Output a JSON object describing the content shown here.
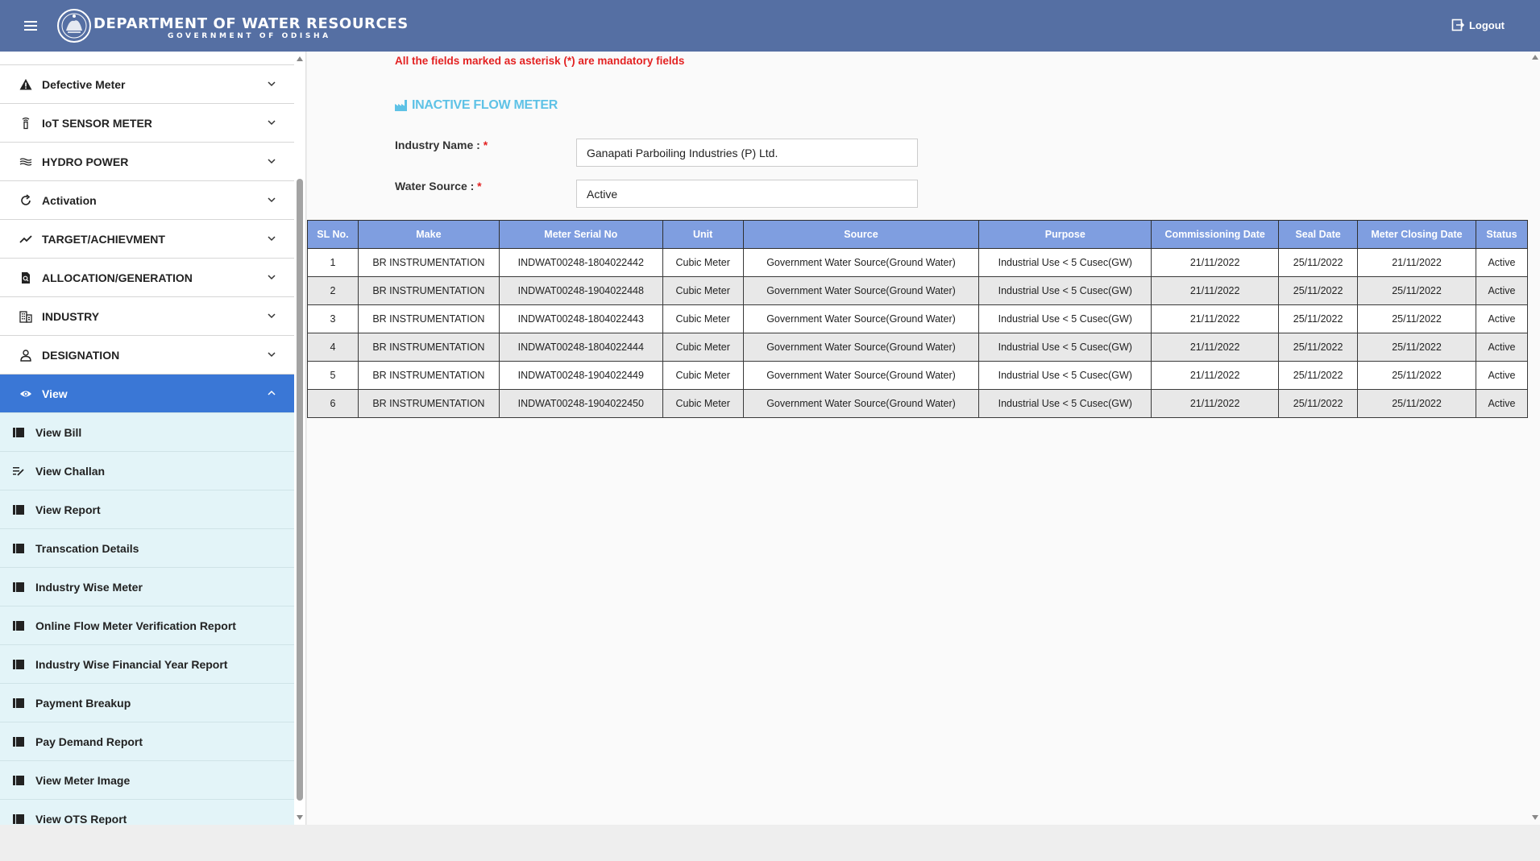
{
  "header": {
    "title": "DEPARTMENT OF WATER RESOURCES",
    "subtitle": "GOVERNMENT OF ODISHA",
    "logout_label": "Logout"
  },
  "sidebar": {
    "menu": [
      {
        "label": "Defective Meter",
        "icon": "warning-icon"
      },
      {
        "label": "IoT SENSOR METER",
        "icon": "sensor-icon"
      },
      {
        "label": "HYDRO POWER",
        "icon": "waves-icon"
      },
      {
        "label": "Activation",
        "icon": "refresh-icon"
      },
      {
        "label": "TARGET/ACHIEVMENT",
        "icon": "trend-icon"
      },
      {
        "label": "ALLOCATION/GENERATION",
        "icon": "document-search-icon"
      },
      {
        "label": "INDUSTRY",
        "icon": "building-icon"
      },
      {
        "label": "DESIGNATION",
        "icon": "person-icon"
      }
    ],
    "active_menu": {
      "label": "View",
      "icon": "eye-icon"
    },
    "sub_items": [
      {
        "label": "View Bill",
        "icon": "list-icon"
      },
      {
        "label": "View Challan",
        "icon": "edit-list-icon"
      },
      {
        "label": "View Report",
        "icon": "list-icon"
      },
      {
        "label": "Transcation Details",
        "icon": "list-icon"
      },
      {
        "label": "Industry Wise Meter",
        "icon": "list-icon"
      },
      {
        "label": "Online Flow Meter Verification Report",
        "icon": "list-icon"
      },
      {
        "label": "Industry Wise Financial Year Report",
        "icon": "list-icon"
      },
      {
        "label": "Payment Breakup",
        "icon": "list-icon"
      },
      {
        "label": "Pay Demand Report",
        "icon": "list-icon"
      },
      {
        "label": "View Meter Image",
        "icon": "list-icon"
      },
      {
        "label": "View OTS Report",
        "icon": "list-icon"
      }
    ]
  },
  "main": {
    "mandatory_note": "All the fields marked as asterisk (*) are mandatory fields",
    "section_title": "INACTIVE FLOW METER",
    "industry_label": "Industry Name :",
    "industry_value": "Ganapati Parboiling Industries (P) Ltd.",
    "water_source_label": "Water Source :",
    "water_source_value": "Active",
    "required_mark": "*"
  },
  "table": {
    "columns": [
      "SL No.",
      "Make",
      "Meter Serial No",
      "Unit",
      "Source",
      "Purpose",
      "Commissioning Date",
      "Seal Date",
      "Meter Closing Date",
      "Status"
    ],
    "rows": [
      [
        "1",
        "BR INSTRUMENTATION",
        "INDWAT00248-1804022442",
        "Cubic Meter",
        "Government Water Source(Ground Water)",
        "Industrial Use < 5 Cusec(GW)",
        "21/11/2022",
        "25/11/2022",
        "21/11/2022",
        "Active"
      ],
      [
        "2",
        "BR INSTRUMENTATION",
        "INDWAT00248-1904022448",
        "Cubic Meter",
        "Government Water Source(Ground Water)",
        "Industrial Use < 5 Cusec(GW)",
        "21/11/2022",
        "25/11/2022",
        "25/11/2022",
        "Active"
      ],
      [
        "3",
        "BR INSTRUMENTATION",
        "INDWAT00248-1804022443",
        "Cubic Meter",
        "Government Water Source(Ground Water)",
        "Industrial Use < 5 Cusec(GW)",
        "21/11/2022",
        "25/11/2022",
        "25/11/2022",
        "Active"
      ],
      [
        "4",
        "BR INSTRUMENTATION",
        "INDWAT00248-1804022444",
        "Cubic Meter",
        "Government Water Source(Ground Water)",
        "Industrial Use < 5 Cusec(GW)",
        "21/11/2022",
        "25/11/2022",
        "25/11/2022",
        "Active"
      ],
      [
        "5",
        "BR INSTRUMENTATION",
        "INDWAT00248-1904022449",
        "Cubic Meter",
        "Government Water Source(Ground Water)",
        "Industrial Use < 5 Cusec(GW)",
        "21/11/2022",
        "25/11/2022",
        "25/11/2022",
        "Active"
      ],
      [
        "6",
        "BR INSTRUMENTATION",
        "INDWAT00248-1904022450",
        "Cubic Meter",
        "Government Water Source(Ground Water)",
        "Industrial Use < 5 Cusec(GW)",
        "21/11/2022",
        "25/11/2022",
        "25/11/2022",
        "Active"
      ]
    ]
  },
  "colors": {
    "header": "#556fa3",
    "active_menu": "#3a77d6",
    "table_header": "#7f9ee0",
    "required": "#e32222",
    "section_title": "#5ec2e6",
    "submenu_bg": "#e3f4f8"
  }
}
